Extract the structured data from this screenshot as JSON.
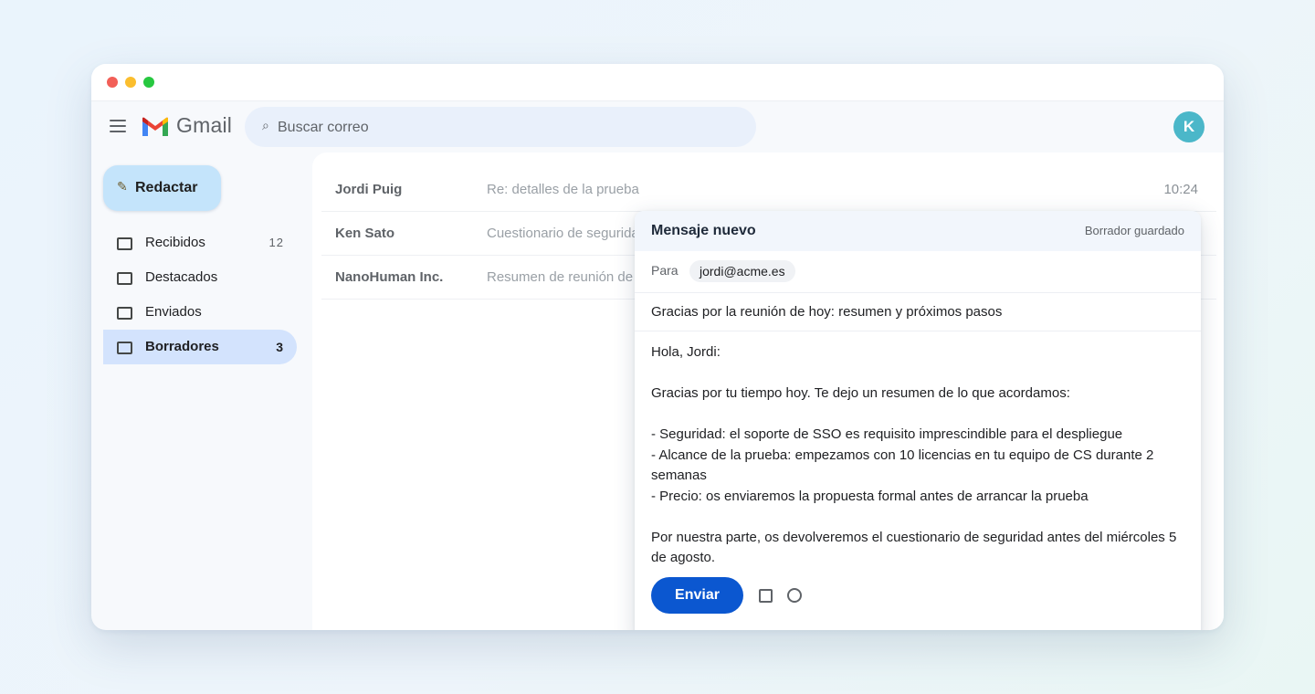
{
  "app": {
    "name": "Gmail",
    "avatar_letter": "K",
    "colors": {
      "accent": "#0b57d0",
      "compose_button": "#c4e4fb",
      "active_nav": "#d3e3fd",
      "avatar": "#4bb7c9"
    }
  },
  "search": {
    "placeholder": "Buscar correo",
    "icon": "search-icon"
  },
  "compose_button": {
    "label": "Redactar",
    "icon": "pencil-icon"
  },
  "sidebar": {
    "items": [
      {
        "label": "Recibidos",
        "count": "12",
        "active": false
      },
      {
        "label": "Destacados",
        "count": "",
        "active": false
      },
      {
        "label": "Enviados",
        "count": "",
        "active": false
      },
      {
        "label": "Borradores",
        "count": "3",
        "active": true
      }
    ]
  },
  "mail_list": [
    {
      "sender": "Jordi Puig",
      "subject": "Re: detalles de la prueba",
      "time": "10:24"
    },
    {
      "sender": "Ken Sato",
      "subject": "Cuestionario de seguridad",
      "time": ""
    },
    {
      "sender": "NanoHuman Inc.",
      "subject": "Resumen de reunión de",
      "time": ""
    }
  ],
  "compose": {
    "title": "Mensaje nuevo",
    "status": "Borrador guardado",
    "to_label": "Para",
    "recipient": "jordi@acme.es",
    "subject": "Gracias por la reunión de hoy: resumen y próximos pasos",
    "body_lines": [
      "Hola, Jordi:",
      "",
      "Gracias por tu tiempo hoy. Te dejo un resumen de lo que acordamos:",
      "",
      "- Seguridad: el soporte de SSO es requisito imprescindible para el despliegue",
      "- Alcance de la prueba: empezamos con 10 licencias en tu equipo de CS durante 2 semanas",
      "- Precio: os enviaremos la propuesta formal antes de arrancar la prueba",
      "",
      "Por nuestra parte, os devolveremos el cuestionario de seguridad antes del miércoles 5 de agosto."
    ],
    "send_label": "Enviar"
  }
}
